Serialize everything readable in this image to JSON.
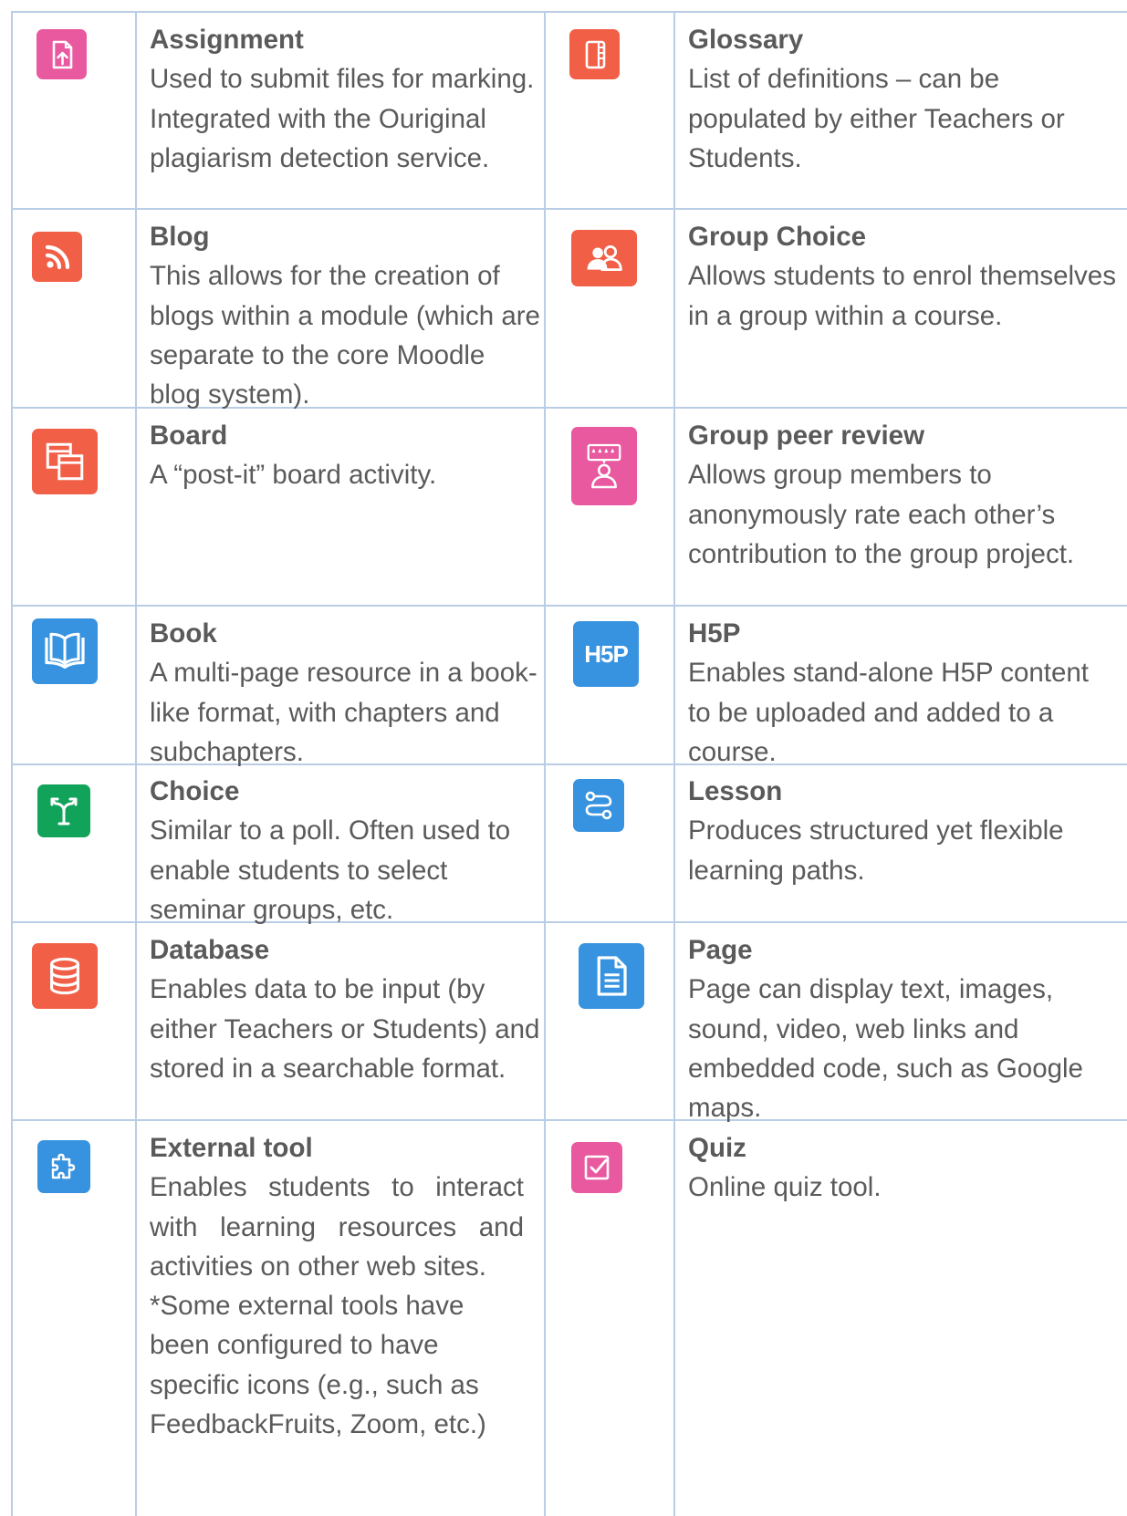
{
  "colors": {
    "border": "#b9cde5",
    "text": "#5a5a5a",
    "pink": "#e9599f",
    "orange": "#f25f47",
    "blue": "#3793e0",
    "green": "#12a35a"
  },
  "items": {
    "assignment": {
      "icon": "file-upload-icon",
      "title": "Assignment",
      "desc": "Used to submit files for marking.  Integrated with the Ouriginal plagiarism detection service."
    },
    "blog": {
      "icon": "rss-feed-icon",
      "title": "Blog",
      "desc": "This allows for the creation of blogs within a module (which are separate to the core Moodle blog system)."
    },
    "board": {
      "icon": "board-icon",
      "title": "Board",
      "desc": "A “post-it” board activity."
    },
    "book": {
      "icon": "open-book-icon",
      "title": "Book",
      "desc": "A multi-page resource in a book-like format, with chapters and subchapters."
    },
    "choice": {
      "icon": "fork-choice-icon",
      "title": "Choice",
      "desc": "Similar to a poll.  Often used to enable students to select seminar groups, etc."
    },
    "database": {
      "icon": "database-icon",
      "title": "Database",
      "desc": "Enables data to be input (by either Teachers or Students) and stored in a searchable format."
    },
    "external_tool": {
      "icon": "puzzle-piece-icon",
      "title": "External tool",
      "desc": "Enables students to interact with learning resources and activities on other web sites.",
      "note": "*Some external tools have been configured to have specific icons (e.g., such as FeedbackFruits, Zoom, etc.)"
    },
    "glossary": {
      "icon": "glossary-book-icon",
      "title": "Glossary",
      "desc": "List of definitions – can be populated by either Teachers or Students."
    },
    "group_choice": {
      "icon": "people-group-icon",
      "title": "Group Choice",
      "desc": "Allows students to enrol themselves in a group within a course."
    },
    "group_peer_review": {
      "icon": "peer-rating-icon",
      "title": "Group peer review",
      "desc": "Allows group members to anonymously rate each other’s contribution to the group project."
    },
    "h5p": {
      "icon": "h5p-icon",
      "icon_text": "H5P",
      "title": "H5P",
      "desc": "Enables stand-alone H5P content to be uploaded and added to a course."
    },
    "lesson": {
      "icon": "lesson-path-icon",
      "title": "Lesson",
      "desc": "Produces structured yet flexible learning paths."
    },
    "page": {
      "icon": "page-document-icon",
      "title": "Page",
      "desc": "Page can display text, images, sound, video, web links and embedded code, such as Google maps."
    },
    "quiz": {
      "icon": "quiz-checkbox-icon",
      "title": "Quiz",
      "desc": "Online quiz tool."
    }
  }
}
